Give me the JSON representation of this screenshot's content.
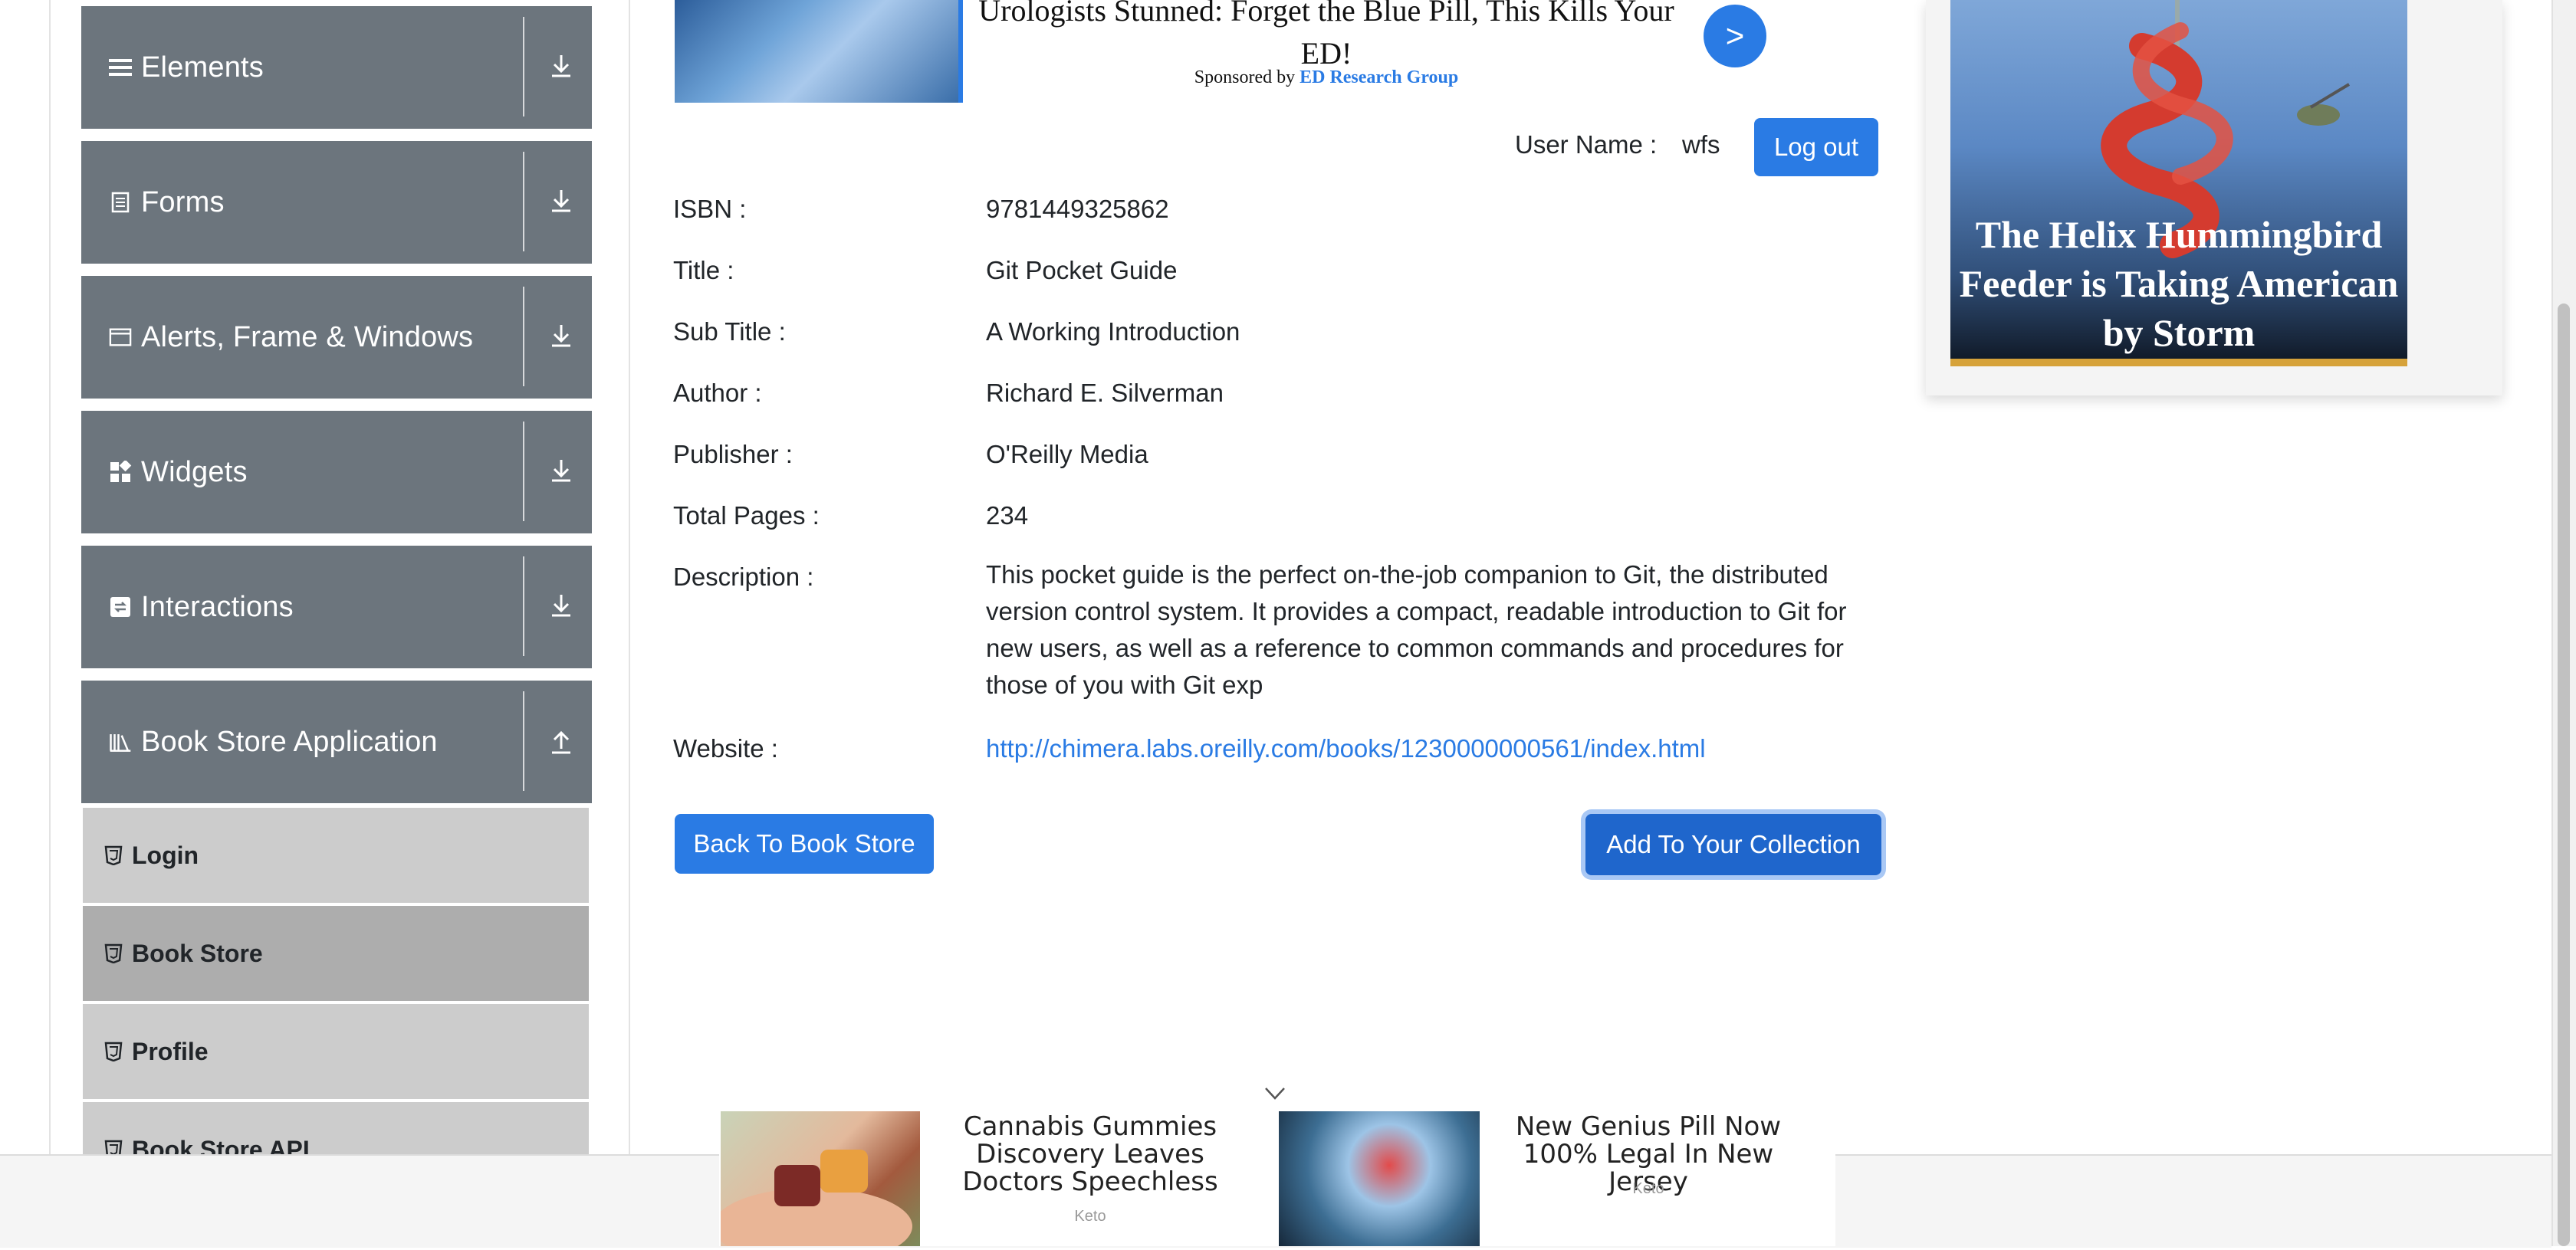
{
  "sidebar": {
    "groups": [
      {
        "label": "Elements",
        "icon": "hamburger-icon"
      },
      {
        "label": "Forms",
        "icon": "document-icon"
      },
      {
        "label": "Alerts, Frame & Windows",
        "icon": "window-icon"
      },
      {
        "label": "Widgets",
        "icon": "widgets-icon"
      },
      {
        "label": "Interactions",
        "icon": "interactions-icon"
      },
      {
        "label": "Book Store Application",
        "icon": "books-icon"
      }
    ],
    "book_store_items": [
      {
        "label": "Login"
      },
      {
        "label": "Book Store"
      },
      {
        "label": "Profile"
      },
      {
        "label": "Book Store API"
      }
    ],
    "active_item": "Book Store"
  },
  "top_ad": {
    "headline": "Urologists Stunned: Forget the Blue Pill, This Kills Your ED!",
    "sponsored_by": "Sponsored by",
    "sponsor": "ED Research Group",
    "button_label": ">"
  },
  "user": {
    "label": "User Name :",
    "value": "wfs",
    "logout_label": "Log out"
  },
  "book": {
    "isbn_label": "ISBN :",
    "isbn": "9781449325862",
    "title_label": "Title :",
    "title": "Git Pocket Guide",
    "subtitle_label": "Sub Title :",
    "subtitle": "A Working Introduction",
    "author_label": "Author :",
    "author": "Richard E. Silverman",
    "publisher_label": "Publisher :",
    "publisher": "O'Reilly Media",
    "pages_label": "Total Pages :",
    "pages": "234",
    "description_label": "Description :",
    "description": "This pocket guide is the perfect on-the-job companion to Git, the distributed version control system. It provides a compact, readable introduction to Git for new users, as well as a reference to common commands and procedures for those of you with Git exp",
    "website_label": "Website :",
    "website": "http://chimera.labs.oreilly.com/books/1230000000561/index.html"
  },
  "actions": {
    "back_label": "Back To Book Store",
    "add_label": "Add To Your Collection"
  },
  "right_ad": {
    "text": "The Helix Hummingbird Feeder is Taking American by Storm"
  },
  "bottom_ads": [
    {
      "headline": "Cannabis Gummies Discovery Leaves Doctors Speechless",
      "source": "Keto"
    },
    {
      "headline": "New Genius Pill Now 100% Legal In New Jersey",
      "source": "Keto"
    }
  ],
  "colors": {
    "accent": "#2a7be4",
    "sidebar_header": "#6c757d",
    "menu_item": "#cccccc",
    "menu_item_active": "#adadad"
  }
}
